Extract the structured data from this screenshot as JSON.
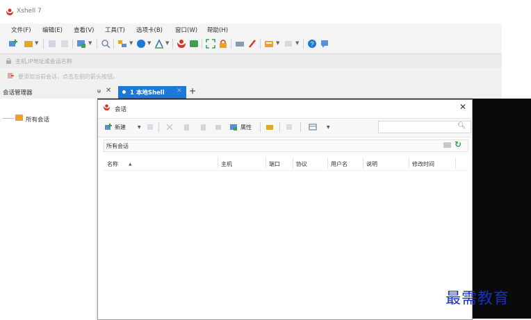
{
  "window": {
    "title": "Xshell 7"
  },
  "menu": [
    "文件(F)",
    "编辑(E)",
    "查看(V)",
    "工具(T)",
    "选项卡(B)",
    "窗口(W)",
    "帮助(H)"
  ],
  "address_bar": {
    "placeholder": "主机,IP地址或会话名称"
  },
  "hint_bar": {
    "text": "要添加当前会话，点击左侧的箭头按钮。"
  },
  "session_manager": {
    "title": "会话管理器",
    "pin": "ᵾ",
    "close": "✕",
    "tree_root": "所有会话"
  },
  "tabs": [
    {
      "label": "1 本地Shell",
      "close": "✕"
    }
  ],
  "tab_add": "+",
  "dialog": {
    "title": "会话",
    "close": "✕",
    "toolbar": {
      "new_label": "新建",
      "properties_label": "属性"
    },
    "path": "所有会话",
    "columns": [
      "名称",
      "主机",
      "端口",
      "协议",
      "用户名",
      "说明",
      "修改时间"
    ],
    "sort_indicator": "▲"
  },
  "watermark": "最需教育",
  "colors": {
    "accent": "#1e78d6",
    "terminal_bg": "#0a0a0a",
    "logo_red": "#d9342b",
    "refresh_green": "#2da64a",
    "watermark": "#1a2fb8"
  }
}
